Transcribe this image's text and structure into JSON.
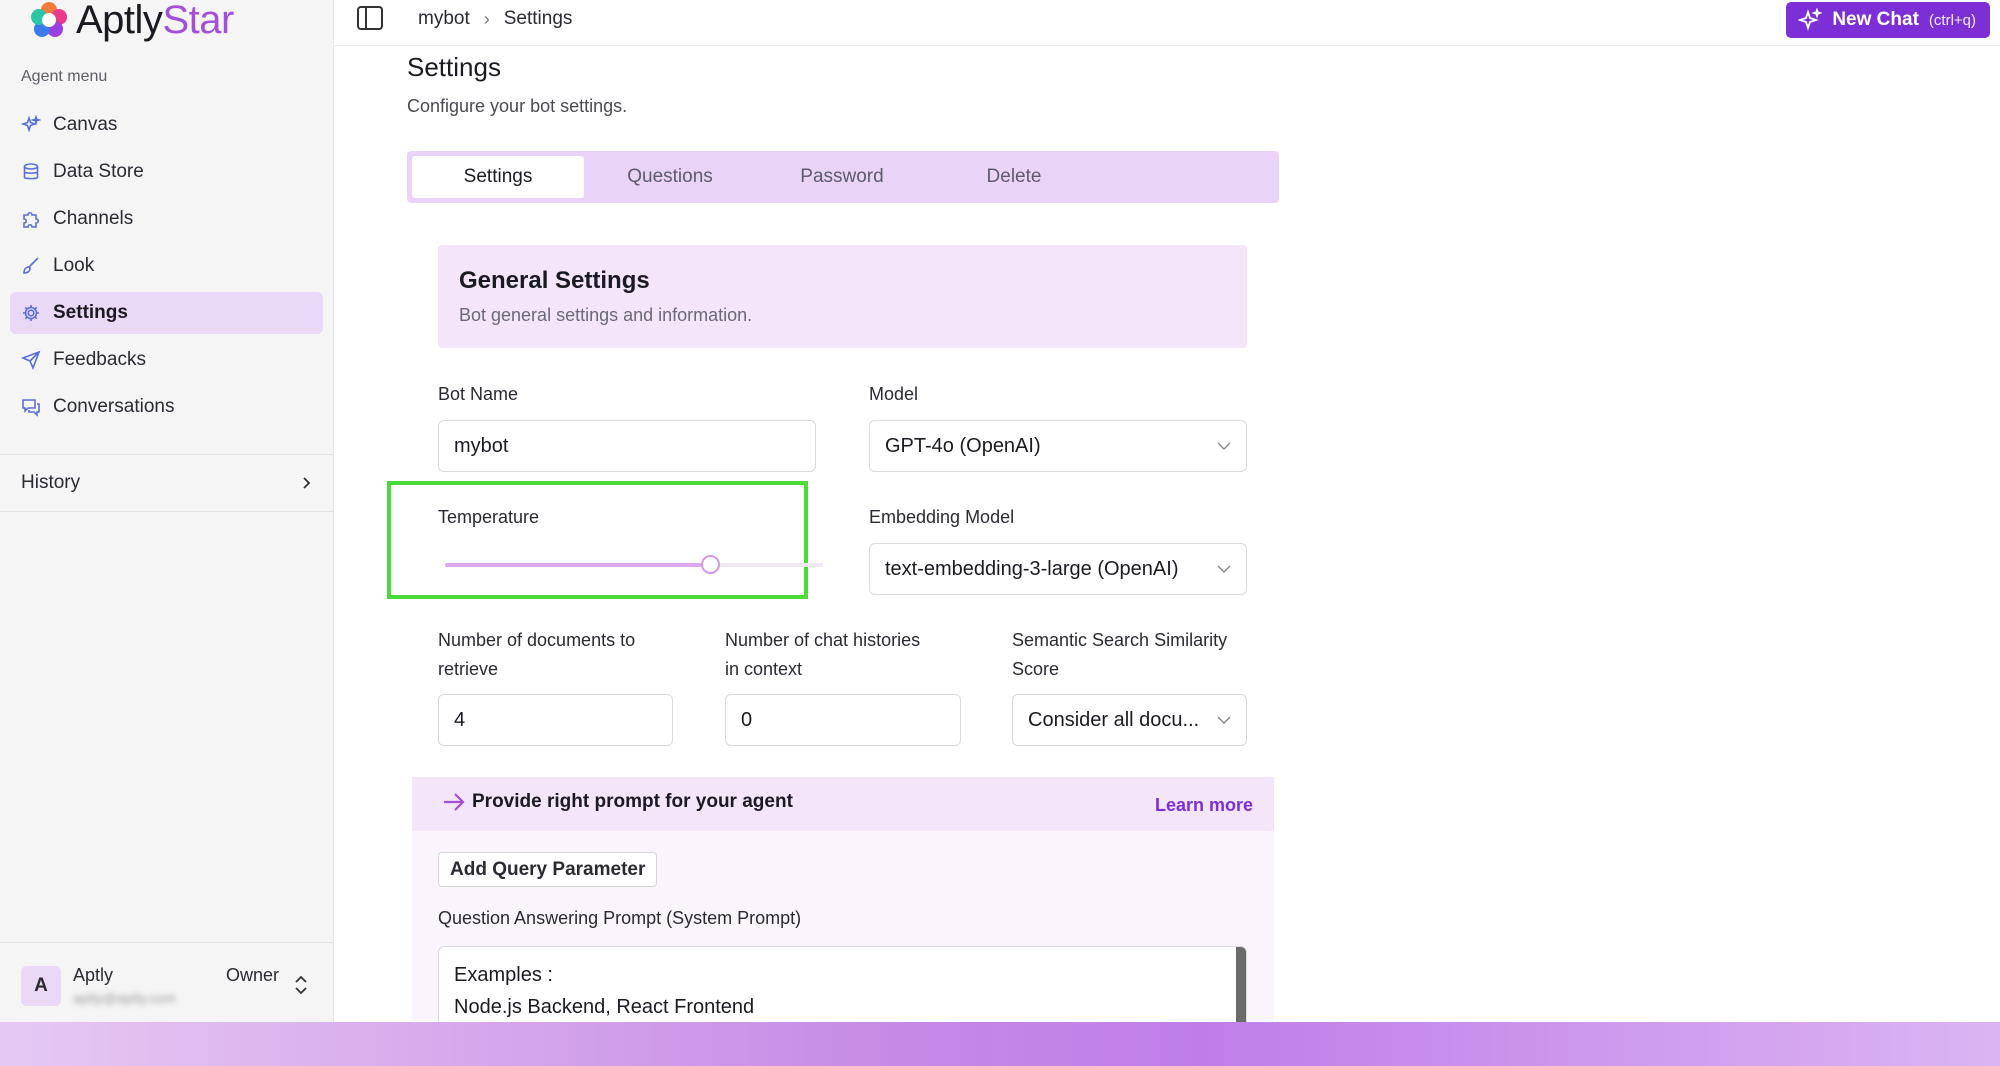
{
  "app": {
    "brand_prefix": "Aptly",
    "brand_suffix": "Star",
    "accent_color": "#7d2fd6"
  },
  "sidebar": {
    "section_label": "Agent menu",
    "items": [
      {
        "label": "Canvas",
        "icon": "sparkles-icon",
        "active": false
      },
      {
        "label": "Data Store",
        "icon": "database-icon",
        "active": false
      },
      {
        "label": "Channels",
        "icon": "puzzle-icon",
        "active": false
      },
      {
        "label": "Look",
        "icon": "brush-icon",
        "active": false
      },
      {
        "label": "Settings",
        "icon": "gear-icon",
        "active": true
      },
      {
        "label": "Feedbacks",
        "icon": "send-icon",
        "active": false
      },
      {
        "label": "Conversations",
        "icon": "chat-icon",
        "active": false
      }
    ],
    "history_label": "History",
    "user": {
      "initial": "A",
      "name": "Aptly",
      "email": "aptly@aptly.com",
      "role": "Owner"
    }
  },
  "topbar": {
    "breadcrumb": [
      "mybot",
      "Settings"
    ],
    "new_chat_label": "New Chat",
    "new_chat_shortcut": "(ctrl+q)"
  },
  "page": {
    "title": "Settings",
    "subtitle": "Configure your bot settings.",
    "tabs": [
      {
        "label": "Settings",
        "active": true
      },
      {
        "label": "Questions",
        "active": false
      },
      {
        "label": "Password",
        "active": false
      },
      {
        "label": "Delete",
        "active": false
      }
    ]
  },
  "general": {
    "title": "General Settings",
    "subtitle": "Bot general settings and information.",
    "bot_name_label": "Bot Name",
    "bot_name_value": "mybot",
    "model_label": "Model",
    "model_value": "GPT-4o (OpenAI)",
    "temperature_label": "Temperature",
    "temperature_fraction": 0.7,
    "embedding_label": "Embedding Model",
    "embedding_value": "text-embedding-3-large (OpenAI)",
    "docs_label_line1": "Number of documents to",
    "docs_label_line2": "retrieve",
    "docs_value": "4",
    "histories_label_line1": "Number of chat histories",
    "histories_label_line2": "in context",
    "histories_value": "0",
    "similarity_label_line1": "Semantic Search Similarity",
    "similarity_label_line2": "Score",
    "similarity_value": "Consider all docu..."
  },
  "prompt": {
    "banner_text": "Provide right prompt for your agent",
    "learn_more": "Learn more",
    "add_param_label": "Add Query Parameter",
    "qa_label": "Question Answering Prompt (System Prompt)",
    "lines": [
      "Examples :",
      "Node.js Backend, React Frontend"
    ]
  }
}
